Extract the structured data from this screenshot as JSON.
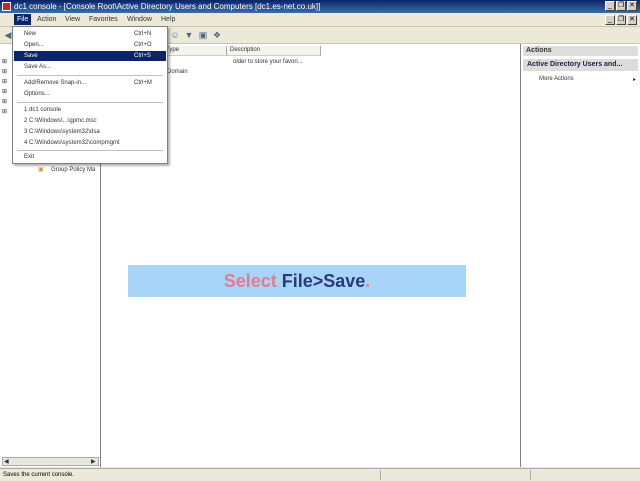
{
  "window": {
    "title": "dc1 console - [Console Root\\Active Directory Users and Computers [dc1.es-net.co.uk]]",
    "minimize": "_",
    "restore": "❐",
    "close": "✕"
  },
  "menubar": {
    "items": [
      "File",
      "Action",
      "View",
      "Favorites",
      "Window",
      "Help"
    ]
  },
  "file_menu": {
    "items": [
      {
        "label": "New",
        "shortcut": "Ctrl+N"
      },
      {
        "label": "Open...",
        "shortcut": "Ctrl+O"
      },
      {
        "label": "Save",
        "shortcut": "Ctrl+S"
      },
      {
        "label": "Save As...",
        "shortcut": ""
      },
      {
        "label": "Add/Remove Snap-in...",
        "shortcut": "Ctrl+M"
      },
      {
        "label": "Options...",
        "shortcut": ""
      },
      {
        "label": "1 dc1 console",
        "shortcut": ""
      },
      {
        "label": "2 C:\\Windows\\...\\gpmc.msc",
        "shortcut": ""
      },
      {
        "label": "3 C:\\Windows\\system32\\dsa",
        "shortcut": ""
      },
      {
        "label": "4 C:\\Windows\\system32\\compmgmt",
        "shortcut": ""
      },
      {
        "label": "Exit",
        "shortcut": ""
      }
    ]
  },
  "left_pane": {
    "tree_item": "Group Policy Ma"
  },
  "center_pane": {
    "columns": [
      "Type",
      "Description"
    ],
    "row1_desc": "older to store your favori...",
    "row2_type": "Domain"
  },
  "actions_pane": {
    "header": "Actions",
    "section": "Active Directory Users and...",
    "more": "More Actions"
  },
  "statusbar": {
    "text": "Saves the current console."
  },
  "callout": {
    "word1": "Select ",
    "word2": "File>Save",
    "word3": "."
  },
  "colors": {
    "callout_bg": "#a8d4f8",
    "callout_accent": "#e87a8c",
    "callout_primary": "#2a3a7a",
    "selection": "#0a246a"
  }
}
